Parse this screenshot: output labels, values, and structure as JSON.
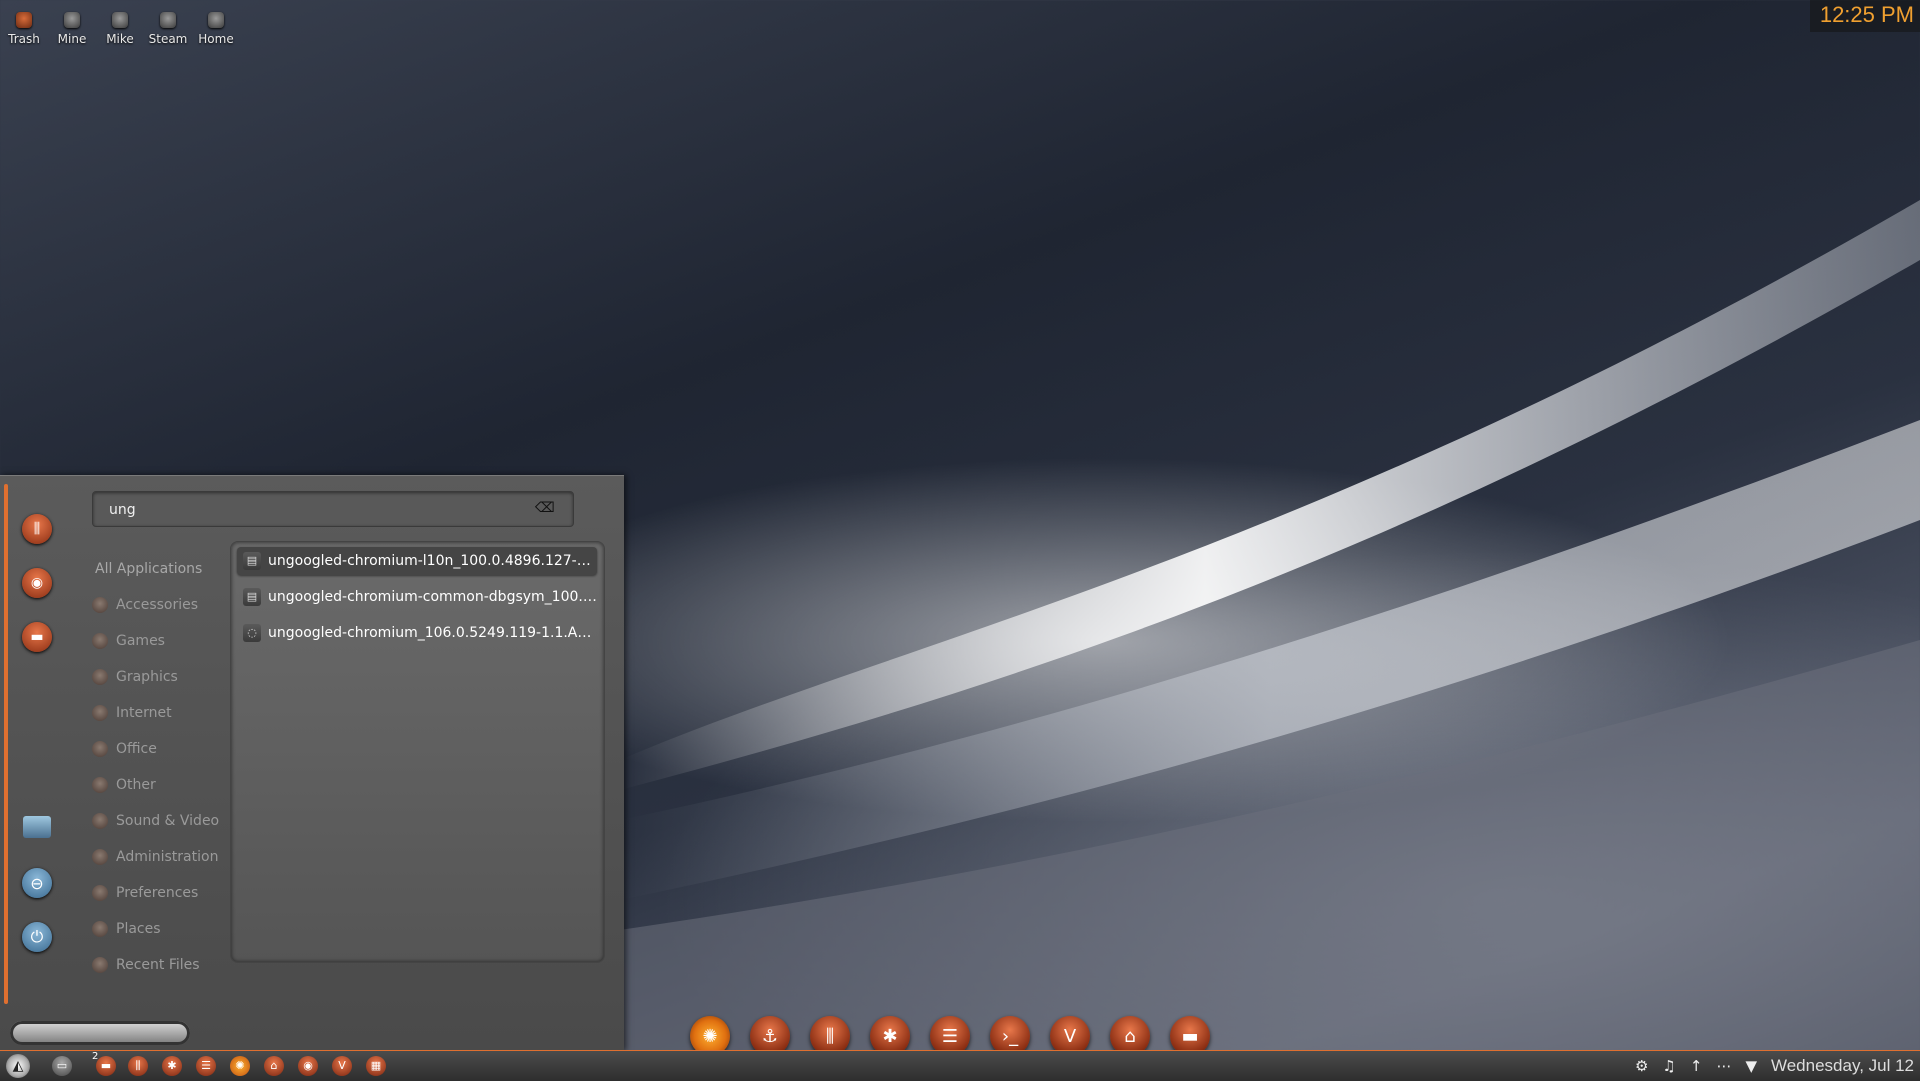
{
  "desktop": {
    "icons": [
      {
        "label": "Trash",
        "icon": "trash-icon"
      },
      {
        "label": "Mine",
        "icon": "drive-icon"
      },
      {
        "label": "Mike",
        "icon": "drive-icon"
      },
      {
        "label": "Steam",
        "icon": "steam-icon"
      },
      {
        "label": "Home",
        "icon": "home-icon"
      }
    ]
  },
  "clock": {
    "time": "12:25 PM"
  },
  "menu": {
    "search": {
      "value": "ung"
    },
    "categories": {
      "all": "All Applications",
      "items": [
        "Accessories",
        "Games",
        "Graphics",
        "Internet",
        "Office",
        "Other",
        "Sound & Video",
        "Administration",
        "Preferences",
        "Places",
        "Recent Files"
      ]
    },
    "results": [
      "ungoogled-chromium-l10n_100.0.4896.127-1.u...",
      "ungoogled-chromium-common-dbgsym_100.0....",
      "ungoogled-chromium_106.0.5249.119-1.1.Appl..."
    ]
  },
  "taskbar": {
    "badge": "2",
    "date": "Wednesday, Jul 12"
  },
  "colors": {
    "accent": "#e07030",
    "clock": "#f0a030"
  }
}
